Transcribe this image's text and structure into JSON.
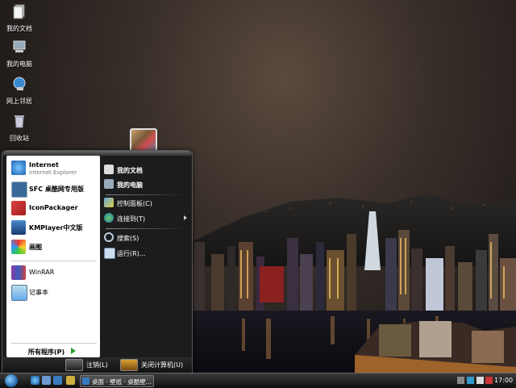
{
  "desktop": {
    "icons": [
      {
        "label": "我的文档",
        "icon": "my-documents-icon"
      },
      {
        "label": "我的电脑",
        "icon": "my-computer-icon"
      },
      {
        "label": "网上邻居",
        "icon": "network-places-icon"
      },
      {
        "label": "回收站",
        "icon": "recycle-bin-icon"
      }
    ]
  },
  "start_menu": {
    "pinned": [
      {
        "title": "Internet",
        "subtitle": "Internet Explorer",
        "icon": "internet-explorer-icon"
      },
      {
        "title": "SFC 桌酷网专用版",
        "icon": "sfc-icon"
      },
      {
        "title": "IconPackager",
        "icon": "iconpackager-icon"
      },
      {
        "title": "KMPlayer中文版",
        "icon": "kmplayer-icon"
      },
      {
        "title": "画图",
        "icon": "paint-icon"
      }
    ],
    "recent": [
      {
        "title": "WinRAR",
        "icon": "winrar-icon"
      },
      {
        "title": "记事本",
        "icon": "notepad-icon"
      }
    ],
    "all_programs": "所有程序(P)",
    "right": [
      {
        "label": "我的文档",
        "icon": "my-documents-icon"
      },
      {
        "label": "我的电脑",
        "icon": "my-computer-icon"
      },
      {
        "label": "控制面板(C)",
        "icon": "control-panel-icon"
      },
      {
        "label": "连接到(T)",
        "icon": "connect-to-icon"
      },
      {
        "label": "搜索(S)",
        "icon": "search-icon"
      },
      {
        "label": "运行(R)...",
        "icon": "run-icon"
      }
    ],
    "logoff": "注销(L)",
    "shutdown": "关闭计算机(U)"
  },
  "taskbar": {
    "window_title": "桌面 · 壁纸 · 桌酷壁...",
    "clock": "17:00"
  },
  "colors": {
    "accent_green": "#2a9a2a",
    "menu_dark": "#1c1c1c"
  }
}
